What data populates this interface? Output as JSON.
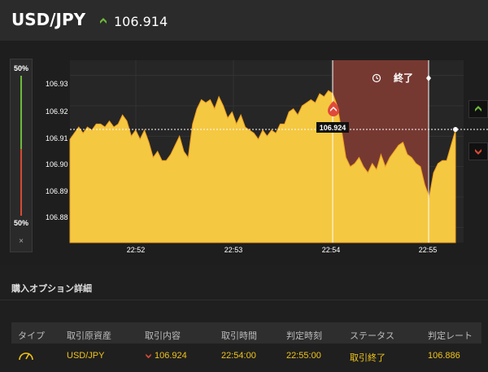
{
  "header": {
    "pair": "USD/JPY",
    "price": "106.914",
    "direction_icon": "up-arrow-icon"
  },
  "ratio": {
    "top_label": "50%",
    "bottom_label": "50%",
    "close_label": "×"
  },
  "chart_data": {
    "type": "area",
    "x_ticks": [
      "22:52",
      "22:53",
      "22:54",
      "22:55"
    ],
    "y_ticks": [
      "106.93",
      "106.92",
      "106.91",
      "106.90",
      "106.89",
      "106.88"
    ],
    "ylim": [
      106.875,
      106.935
    ],
    "entry_rate": "106.924",
    "expiry_label": "終了",
    "series": [
      {
        "values": [
          106.909,
          106.911,
          106.913,
          106.911,
          106.913,
          106.912,
          106.914,
          106.914,
          106.913,
          106.915,
          106.913,
          106.914,
          106.917,
          106.915,
          106.91,
          106.912,
          106.909,
          106.912,
          106.908,
          106.903,
          106.905,
          106.902,
          106.902,
          106.904,
          106.907,
          106.91,
          106.905,
          106.903,
          106.914,
          106.919,
          106.922,
          106.921,
          106.922,
          106.919,
          106.923,
          106.92,
          106.916,
          106.918,
          106.914,
          106.917,
          106.913,
          106.912,
          106.911,
          106.909,
          106.912,
          106.91,
          106.912,
          106.911,
          106.914,
          106.914,
          106.918,
          106.919,
          106.917,
          106.92,
          106.921,
          106.922,
          106.921,
          106.924,
          106.923,
          106.925,
          106.924,
          106.92,
          106.912,
          106.903,
          106.9,
          106.901,
          106.903,
          106.9,
          106.898,
          106.901,
          106.899,
          106.904,
          106.9,
          106.903,
          106.905,
          106.907,
          106.908,
          106.904,
          106.903,
          106.901,
          106.9,
          106.894,
          106.89,
          106.898,
          106.901,
          106.902,
          106.902,
          106.907,
          106.912
        ]
      }
    ]
  },
  "section": {
    "title": "購入オプション詳細"
  },
  "table": {
    "headers": [
      "タイプ",
      "取引原資産",
      "取引内容",
      "取引時間",
      "判定時刻",
      "ステータス",
      "判定レート"
    ],
    "row": {
      "asset": "USD/JPY",
      "content": "106.924",
      "time": "22:54:00",
      "judge_time": "22:55:00",
      "status": "取引終了",
      "rate": "106.886"
    }
  },
  "colors": {
    "area": "#f5c842",
    "area_line": "#f0c419",
    "expired_region": "#7a3a33",
    "up": "#6dba3b",
    "down": "#d94a34"
  }
}
